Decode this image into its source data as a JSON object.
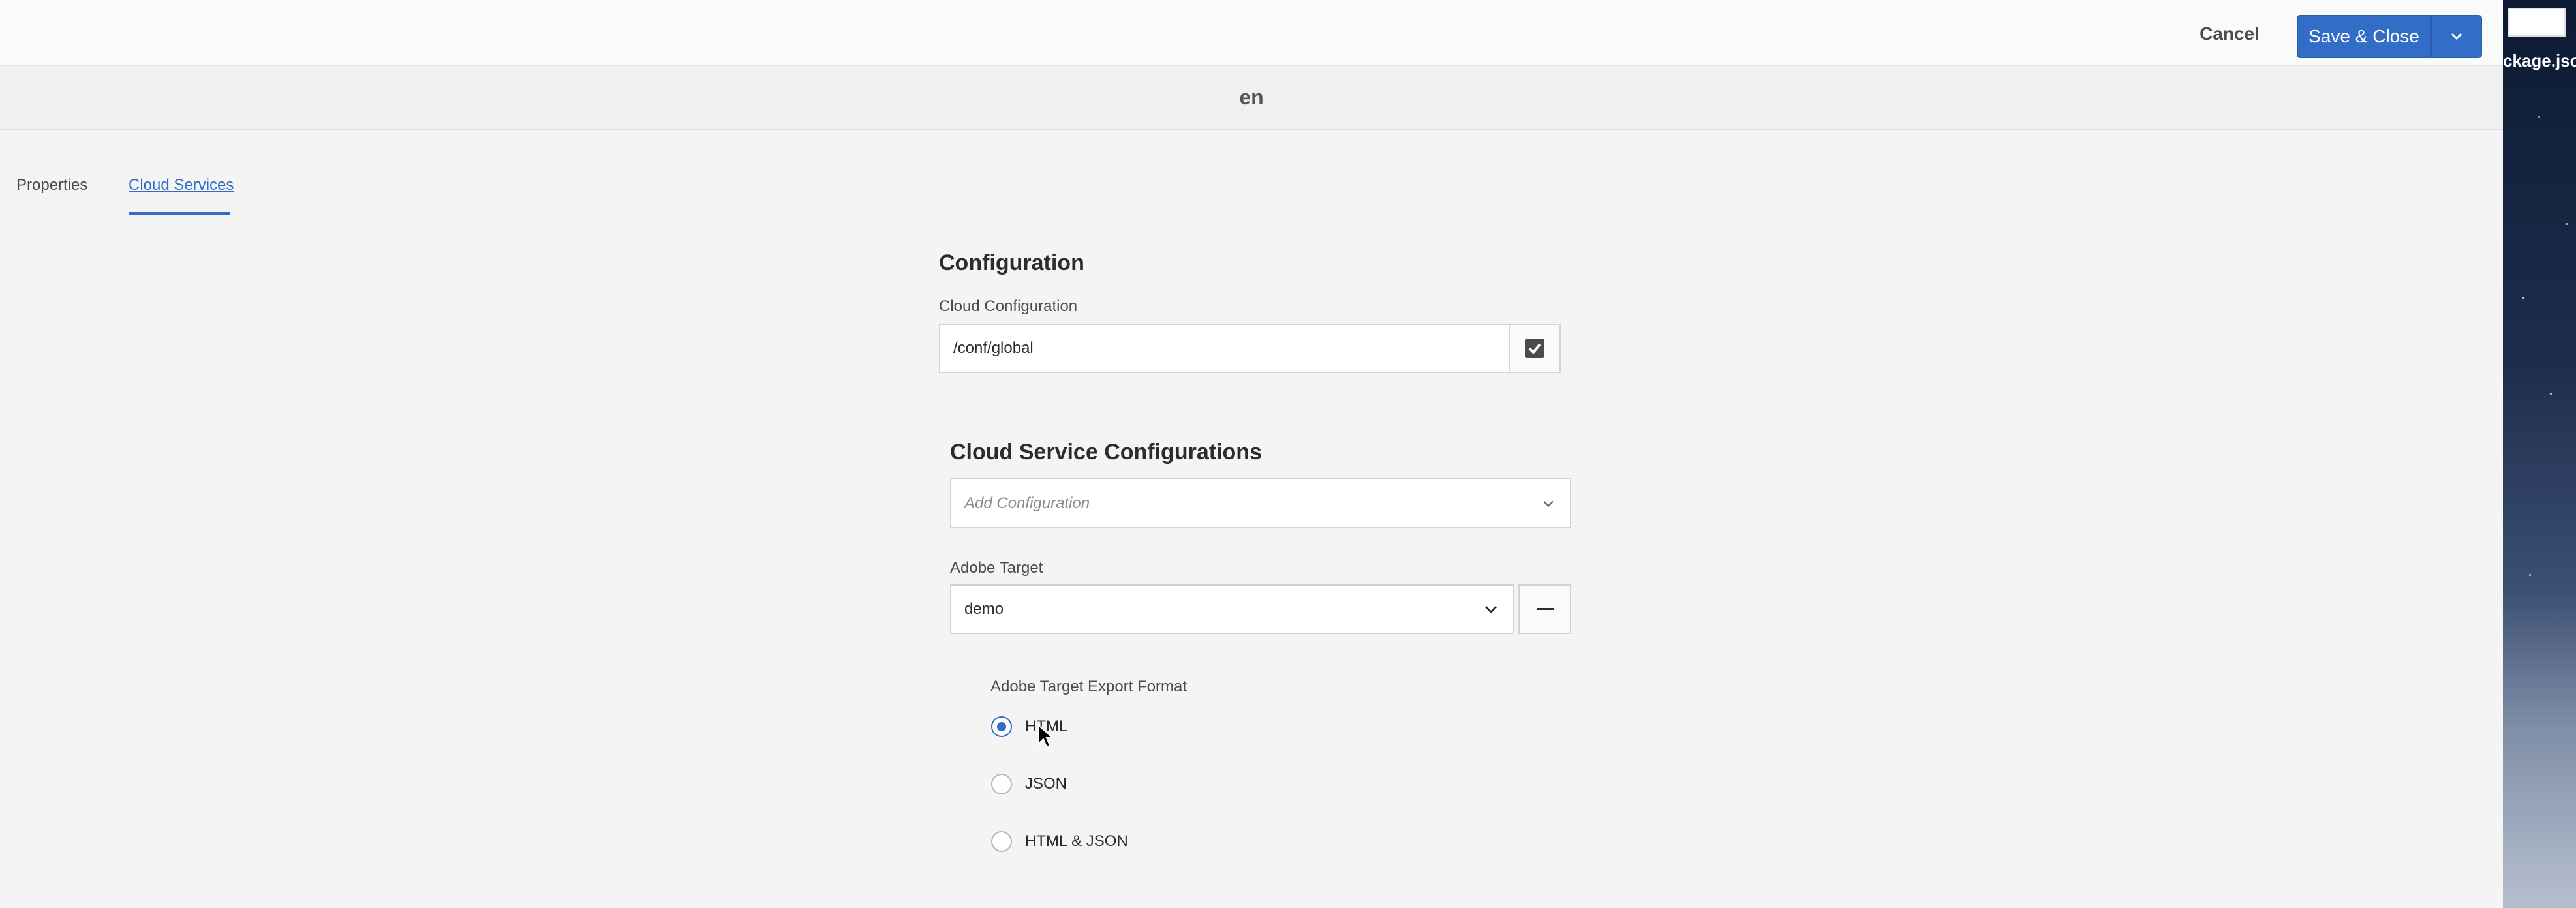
{
  "toolbar": {
    "cancel_label": "Cancel",
    "save_label": "Save & Close"
  },
  "page": {
    "title": "en"
  },
  "tabs": [
    {
      "label": "Properties"
    },
    {
      "label": "Cloud Services"
    }
  ],
  "configuration": {
    "heading": "Configuration",
    "field_label": "Cloud Configuration",
    "field_value": "/conf/global"
  },
  "cloud_services": {
    "heading": "Cloud Service Configurations",
    "add_placeholder": "Add Configuration",
    "target_label": "Adobe Target",
    "target_value": "demo",
    "export_format_label": "Adobe Target Export Format",
    "formats": [
      {
        "label": "HTML",
        "checked": true
      },
      {
        "label": "JSON",
        "checked": false
      },
      {
        "label": "HTML & JSON",
        "checked": false
      }
    ]
  },
  "desktop": {
    "file_label": "ckage.jso"
  },
  "colors": {
    "accent": "#326ec8",
    "background": "#f4f4f4"
  }
}
